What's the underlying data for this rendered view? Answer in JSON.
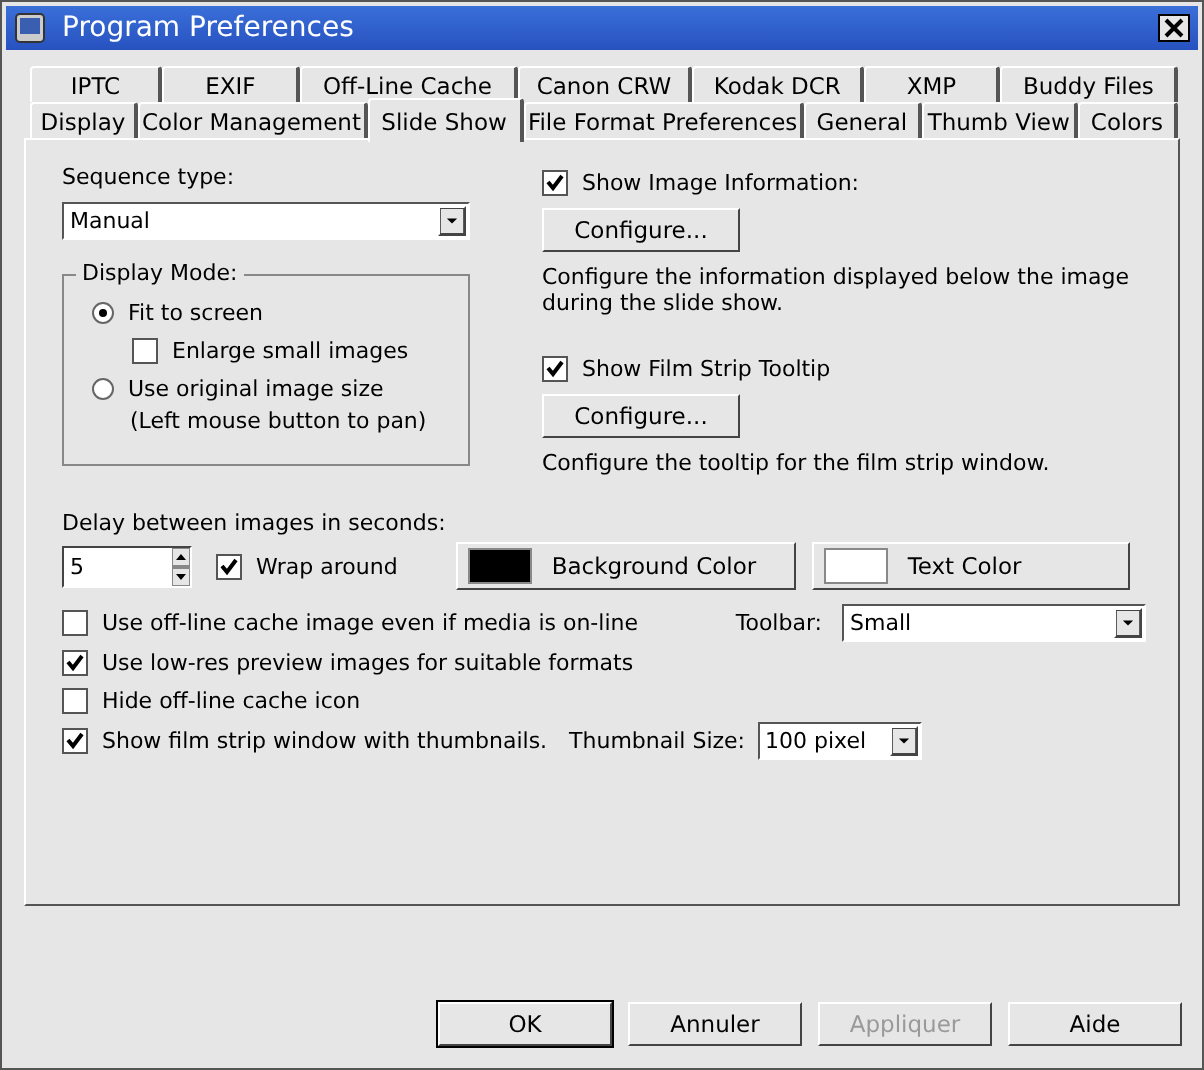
{
  "window": {
    "title": "Program Preferences"
  },
  "tab_rows": [
    {
      "tabs": [
        {
          "label": "IPTC",
          "selected": false
        },
        {
          "label": "EXIF",
          "selected": false
        },
        {
          "label": "Off-Line Cache",
          "selected": false
        },
        {
          "label": "Canon CRW",
          "selected": false
        },
        {
          "label": "Kodak DCR",
          "selected": false
        },
        {
          "label": "XMP",
          "selected": false
        },
        {
          "label": "Buddy Files",
          "selected": false
        }
      ]
    },
    {
      "tabs": [
        {
          "label": "Display",
          "selected": false
        },
        {
          "label": "Color Management",
          "selected": false
        },
        {
          "label": "Slide Show",
          "selected": true
        },
        {
          "label": "File Format Preferences",
          "selected": false
        },
        {
          "label": "General",
          "selected": false
        },
        {
          "label": "Thumb View",
          "selected": false
        },
        {
          "label": "Colors",
          "selected": false
        }
      ]
    }
  ],
  "sequence_type": {
    "label": "Sequence type:",
    "value": "Manual"
  },
  "display_mode": {
    "title": "Display Mode:",
    "options": [
      {
        "kind": "radio",
        "label": "Fit to screen",
        "selected": true
      },
      {
        "kind": "checkbox",
        "label": "Enlarge small images",
        "checked": false
      },
      {
        "kind": "radio",
        "label": "Use original image size",
        "selected": false,
        "note": "(Left mouse button to pan)"
      }
    ]
  },
  "info_sections": [
    {
      "label": "Show Image Information:",
      "checked": true,
      "button": "Configure...",
      "description": "Configure the information displayed below the image during the slide show."
    },
    {
      "label": "Show Film Strip Tooltip",
      "checked": true,
      "button": "Configure...",
      "description": "Configure the tooltip for the film strip window."
    }
  ],
  "delay": {
    "label": "Delay between images in seconds:",
    "value": "5",
    "wrap_around": {
      "label": "Wrap around",
      "checked": true
    }
  },
  "color_buttons": [
    {
      "label": "Background Color",
      "color": "#000000"
    },
    {
      "label": "Text Color",
      "color": "#ffffff"
    }
  ],
  "toolbar": {
    "label": "Toolbar:",
    "value": "Small"
  },
  "options": [
    {
      "label": "Use off-line cache image even if media is on-line",
      "checked": false
    },
    {
      "label": "Use low-res preview images for suitable formats",
      "checked": true
    },
    {
      "label": "Hide off-line cache icon",
      "checked": false
    },
    {
      "label": "Show film strip window with thumbnails.",
      "checked": true,
      "thumbnail_size": {
        "label": "Thumbnail Size:",
        "value": "100 pixel"
      }
    }
  ],
  "buttons": [
    {
      "label": "OK",
      "disabled": false,
      "default": true
    },
    {
      "label": "Annuler",
      "disabled": false,
      "default": false
    },
    {
      "label": "Appliquer",
      "disabled": true,
      "default": false
    },
    {
      "label": "Aide",
      "disabled": false,
      "default": false
    }
  ]
}
